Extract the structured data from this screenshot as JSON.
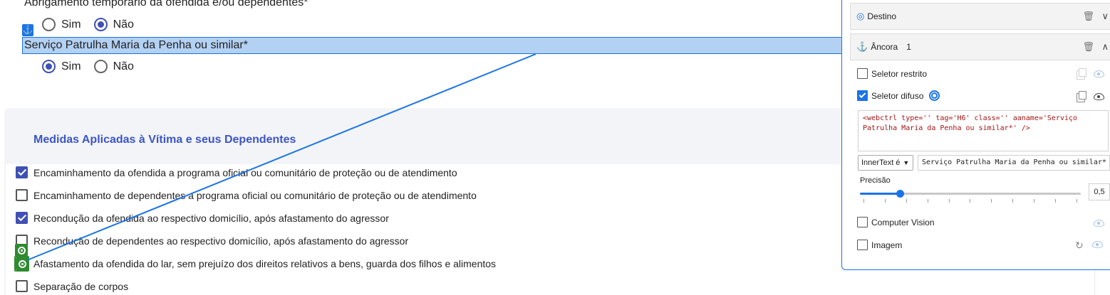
{
  "form": {
    "question1": "Abrigamento temporário da ofendida e/ou dependentes*",
    "q1_options": [
      {
        "label": "Sim",
        "selected": false
      },
      {
        "label": "Não",
        "selected": true
      }
    ],
    "anchor_badge": "⚓",
    "question2": "Serviço Patrulha Maria da Penha ou similar*",
    "q2_options": [
      {
        "label": "Sim",
        "selected": true
      },
      {
        "label": "Não",
        "selected": false
      }
    ]
  },
  "card": {
    "title": "Medidas Aplicadas à Vítima e seus Dependentes",
    "items": [
      {
        "label": "Encaminhamento da ofendida a programa oficial ou comunitário de proteção ou de atendimento",
        "checked": true
      },
      {
        "label": "Encaminhamento de dependentes a programa oficial ou comunitário de proteção ou de atendimento",
        "checked": false
      },
      {
        "label": "Recondução da ofendida ao respectivo domicílio, após afastamento do agressor",
        "checked": true
      },
      {
        "label": "Recondução de dependentes ao respectivo domicílio, após afastamento do agressor",
        "checked": false
      },
      {
        "label": "Afastamento da ofendida do lar, sem prejuízo dos direitos relativos a bens, guarda dos filhos e alimentos",
        "checked": false
      },
      {
        "label": "Separação de corpos",
        "checked": false
      }
    ]
  },
  "panel": {
    "destino": {
      "icon": "target-icon",
      "label": "Destino",
      "trash": "🗑",
      "chevron": "∨"
    },
    "ancora": {
      "icon": "anchor-icon",
      "icon_glyph": "⚓",
      "label": "Âncora",
      "count": "1",
      "trash": "🗑",
      "chevron": "∧"
    },
    "seletor_restrito": {
      "label": "Seletor restrito",
      "checked": false
    },
    "seletor_difuso": {
      "label": "Seletor difuso",
      "checked": true
    },
    "selector_code": "<webctrl type='' tag='H6' class='' aaname='Serviço Patrulha Maria da Penha ou similar*' />",
    "match_mode": "InnerText é",
    "match_value": "Serviço Patrulha Maria da Penha ou similar*",
    "precision_label": "Precisão",
    "precision_value": "0,5",
    "precision_fraction": 0.18,
    "computer_vision": {
      "label": "Computer Vision",
      "checked": false
    },
    "imagem": {
      "label": "Imagem",
      "checked": false
    },
    "accent_color": "#1a73e8"
  }
}
